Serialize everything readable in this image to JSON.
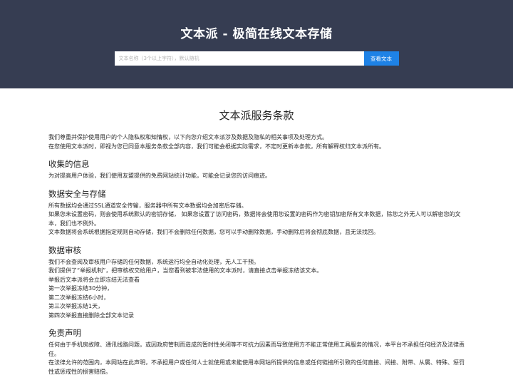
{
  "header": {
    "title": "文本派 - 极简在线文本存储",
    "search": {
      "placeholder": "文本名称（3个以上字符），默认随机",
      "value": "",
      "button_label": "查看文本"
    },
    "colors": {
      "background": "#363d52",
      "button": "#1e82e6"
    }
  },
  "terms": {
    "title": "文本派服务条款",
    "intro": [
      "我们尊重并保护使用用户的个人隐私权和知情权，以下向您介绍文本派涉及数据及隐私的相关事项及处理方式。",
      "在您使用文本派时，即视为您已同意本服务条款全部内容，我们可能会根据实际需求，不定时更新本条款，所有解释权归文本派所有。"
    ],
    "sections": [
      {
        "heading": "收集的信息",
        "paragraphs": [
          "为对提高用户体验，我们使用友盟提供的免费网站统计功能，可能会记录您的访问痕迹。"
        ]
      },
      {
        "heading": "数据安全与存储",
        "paragraphs": [
          "所有数据均会通过SSL通道安全传输，服务器中所有文本数据均会加密后存储。",
          "如果您未设置密码，则会使用系统默认的密钥存储， 如果您设置了访问密码，数据将会使用您设置的密码作为密钥加密所有文本数据，除您之外无人可以解密您的文本，我们也不例外。",
          "文本数据将会系统根据指定规则自动存储，我们不会删除任何数据，您可以手动删除数据，手动删除后将会彻底数据，且无法找回。"
        ]
      },
      {
        "heading": "数据审核",
        "paragraphs": [
          "我们不会查阅及审核用户存储的任何数据，系统运行均全自动化处理，无人工干预。",
          "我们提供了“举报机制”，把审核权交给用户，当您看到被非法使用的文本派时，请直接点击举报冻结该文本。",
          "举报后文本派将会立即冻结无法查看",
          "第一次举报冻结30分钟，",
          "第二次举报冻结6小时，",
          "第三次举报冻结1天，",
          "第四次举报直接删除全部文本记录"
        ]
      },
      {
        "heading": "免责声明",
        "paragraphs": [
          "任何由于手机房故障、通讯线路问题，或因政府管制而造成的暂时性关闭等不可抗力因素而导致使用方不能正常使用工具服务的情况，本平台不承担任何经济及法律责任。",
          "在法律允许的范围内，本网站在此声明，不承担用户或任何人士就使用或未能使用本网站所提供的信息或任何链接所引致的任何直接、间接、附带、从属、特殊、惩罚性或惩戒性的损害赔偿。"
        ]
      }
    ]
  }
}
